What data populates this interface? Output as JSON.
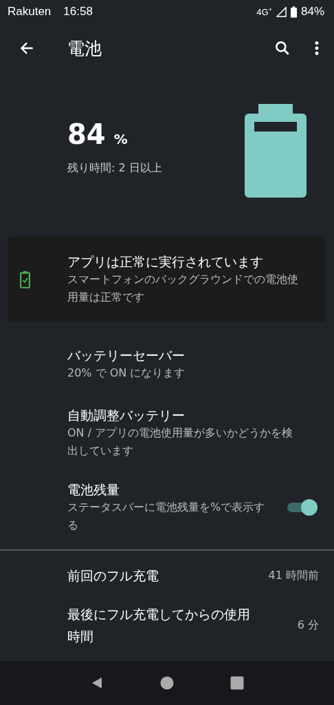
{
  "status_bar": {
    "carrier": "Rakuten",
    "time": "16:58",
    "network": "4G$^{+}$",
    "battery": "84%"
  },
  "toolbar": {
    "title": "電池"
  },
  "summary": {
    "percent": "84",
    "unit": "%",
    "remaining": "残り時間: 2 日以上"
  },
  "alert": {
    "title": "アプリは正常に実行されています",
    "description": "スマートフォンのバックグラウンドでの電池使用量は正常です"
  },
  "settings": [
    {
      "kind": "text",
      "title": "バッテリーセーバー",
      "summary": "20% で ON になります"
    },
    {
      "kind": "text",
      "title": "自動調整バッテリー",
      "summary": "ON / アプリの電池使用量が多いかどうかを検出しています"
    },
    {
      "kind": "toggle",
      "title": "電池残量",
      "summary": "ステータスバーに電池残量を%で表示する",
      "on": true
    }
  ],
  "usage": [
    {
      "title": "前回のフル充電",
      "value": "41 時間前"
    },
    {
      "title": "最後にフル充電してからの使用時間",
      "value": "6 分"
    }
  ]
}
